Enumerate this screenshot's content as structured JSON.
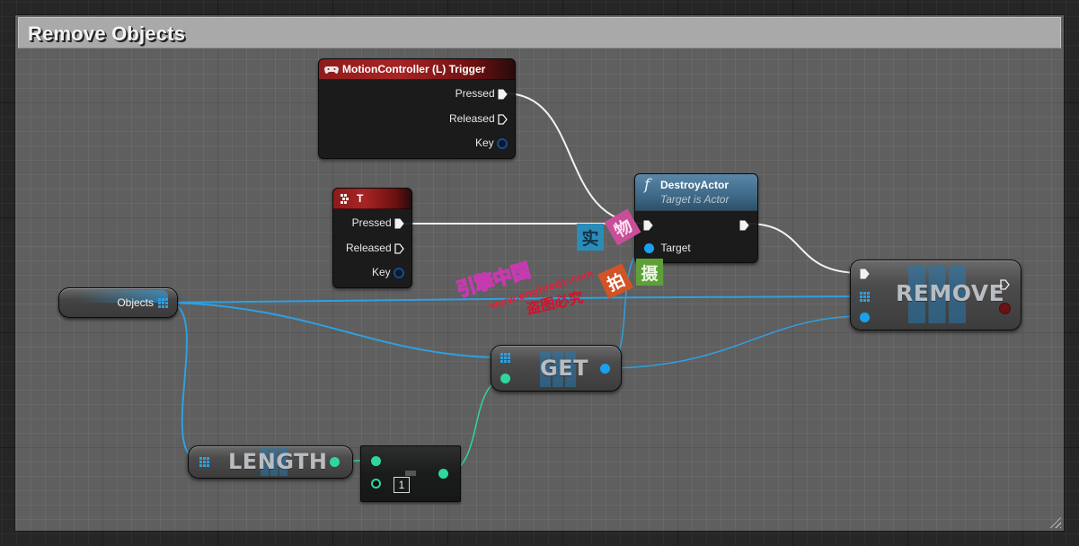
{
  "comment": {
    "title": "Remove Objects"
  },
  "nodes": {
    "motion_controller": {
      "title": "MotionController (L) Trigger",
      "icon": "gamepad-icon",
      "pins": [
        "Pressed",
        "Released",
        "Key"
      ]
    },
    "key_t": {
      "title": "T",
      "icon": "keyboard-icon",
      "pins": [
        "Pressed",
        "Released",
        "Key"
      ]
    },
    "destroy_actor": {
      "title": "DestroyActor",
      "subtitle": "Target is Actor",
      "icon": "function-icon",
      "icon_glyph": "f",
      "pins": [
        "Target"
      ]
    },
    "objects_var": {
      "label": "Objects"
    },
    "remove": {
      "label": "REMOVE"
    },
    "get": {
      "label": "GET"
    },
    "length": {
      "label": "LENGTH"
    },
    "subtract": {
      "value": "1"
    }
  },
  "watermark": {
    "tiles": [
      "实",
      "物",
      "拍",
      "摄"
    ],
    "site_cn": "引擎中国",
    "site_url": "www.enginedx.com",
    "warning": "盗图必究"
  },
  "colors": {
    "exec_wire": "#f2f2f2",
    "object_wire": "#2fa0e0",
    "int_wire": "#2fd6a0",
    "event_header": "#a82424",
    "function_header": "#4a7898",
    "comment_header": "#a9a9a9"
  }
}
